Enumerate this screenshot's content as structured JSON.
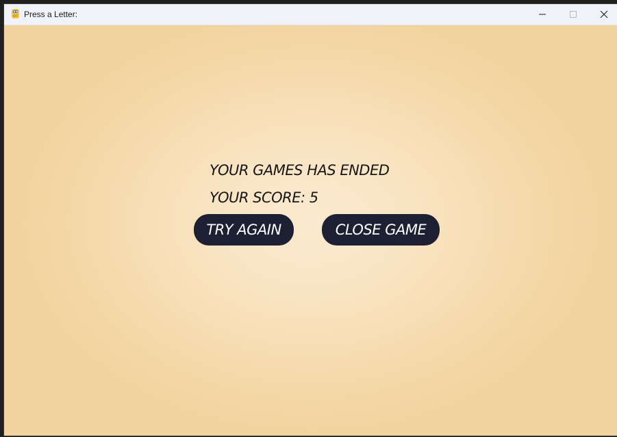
{
  "window": {
    "title": "Press a Letter:",
    "icon": "pygame-snake-icon",
    "controls": {
      "minimize_icon": "minimize-icon",
      "maximize_icon": "maximize-icon",
      "close_icon": "close-icon"
    }
  },
  "game_over": {
    "ended_text": "YOUR GAMES HAS ENDED",
    "score_text": "YOUR SCORE: 5",
    "try_again_label": "TRY AGAIN",
    "close_game_label": "CLOSE GAME"
  },
  "colors": {
    "background_center": "#fbead0",
    "background_edge": "#f2d39f",
    "button_fill": "#1d2033",
    "button_text": "#ffffff",
    "text": "#161616"
  }
}
